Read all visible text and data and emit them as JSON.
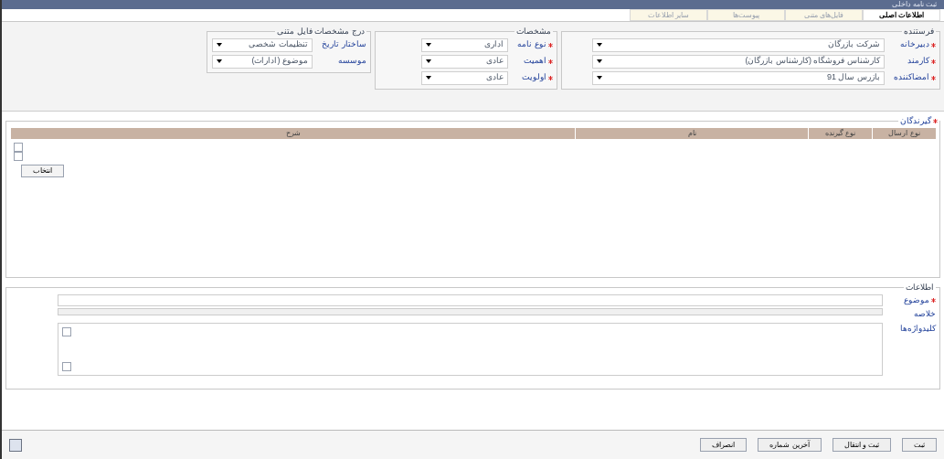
{
  "window": {
    "title": "ثبت نامه داخلی"
  },
  "tabs": [
    {
      "label": "اطلاعات اصلی",
      "selected": true
    },
    {
      "label": "فایل‌های متنی",
      "selected": false
    },
    {
      "label": "پیوست‌ها",
      "selected": false
    },
    {
      "label": "سایر اطلاعات",
      "selected": false
    }
  ],
  "sender": {
    "title": "فرستنده",
    "fields": [
      {
        "label": "دبیرخانه",
        "required": true,
        "value": "شرکت بازرگان"
      },
      {
        "label": "کارمند",
        "required": true,
        "value": "کارشناس فروشگاه (کارشناس بازرگان)"
      },
      {
        "label": "امضاکننده",
        "required": true,
        "value": "بازرس سال 91"
      }
    ]
  },
  "specs": {
    "title": "مشخصات",
    "fields": [
      {
        "label": "نوع نامه",
        "required": true,
        "value": "اداری"
      },
      {
        "label": "اهمیت",
        "required": true,
        "value": "عادی"
      },
      {
        "label": "اولویت",
        "required": true,
        "value": "عادی"
      }
    ]
  },
  "text_file": {
    "title": "درج مشخصات فایل متنی",
    "fields": [
      {
        "label": "ساختار تاریخ",
        "required": false,
        "value": "تنظیمات شخصی"
      },
      {
        "label": "موسسه",
        "required": false,
        "value": "موضوع (ادارات)"
      }
    ]
  },
  "recipients": {
    "title": "گیرندگان",
    "required": true,
    "columns": [
      "نوع ارسال",
      "نوع گیرنده",
      "نام",
      "شرح"
    ],
    "select_button": "انتخاب"
  },
  "info": {
    "title": "اطلاعات",
    "fields": [
      {
        "label": "موضوع",
        "required": true,
        "kind": "line"
      },
      {
        "label": "خلاصه",
        "required": false,
        "kind": "toolbar"
      },
      {
        "label": "کلیدواژه‌ها",
        "required": false,
        "kind": "area"
      }
    ]
  },
  "footer_buttons": [
    "ثبت",
    "ثبت و انتقال",
    "آخرین شماره",
    "انصراف"
  ]
}
